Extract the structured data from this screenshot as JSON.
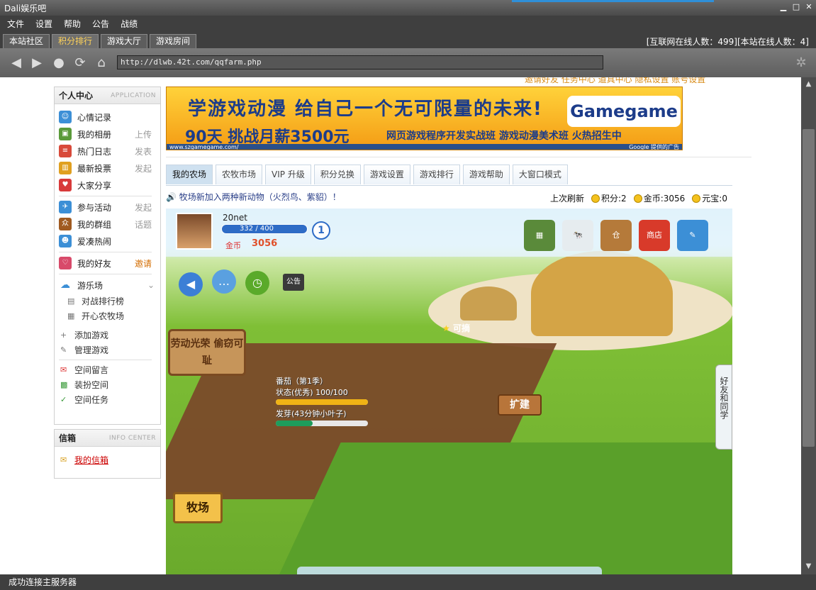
{
  "window": {
    "title": "Dali娱乐吧",
    "minimize": "▁",
    "maximize": "□",
    "close": "✕"
  },
  "menu": [
    "文件",
    "设置",
    "帮助",
    "公告",
    "战绩"
  ],
  "tabs": [
    {
      "label": "本站社区",
      "active": false
    },
    {
      "label": "积分排行",
      "active": true
    },
    {
      "label": "游戏大厅",
      "active": false
    },
    {
      "label": "游戏房间",
      "active": false
    }
  ],
  "online": "[互联网在线人数：499][本站在线人数：4]",
  "toolbar": {
    "address": "http://dlwb.42t.com/qqfarm.php"
  },
  "icons": {
    "back": "back-icon",
    "forward": "forward-icon",
    "stop": "stop-icon",
    "refresh": "refresh-icon",
    "home": "home-icon",
    "settings": "gear-icon"
  },
  "top_links": "邀请好友   任务中心   道具中心   隐私设置   账号设置",
  "personal": {
    "title": "个人中心",
    "title_en": "APPLICATION",
    "items": [
      {
        "label": "心情记录",
        "right": "",
        "color": "#3c8fd6"
      },
      {
        "label": "我的相册",
        "right": "上传",
        "color": "#5a9a3a"
      },
      {
        "label": "热门日志",
        "right": "发表",
        "color": "#d84a3a"
      },
      {
        "label": "最新投票",
        "right": "发起",
        "color": "#e0a020"
      },
      {
        "label": "大家分享",
        "right": "",
        "color": "#d83a3a"
      },
      {
        "label": "参与活动",
        "right": "发起",
        "color": "#3c8fd6"
      },
      {
        "label": "我的群组",
        "right": "话题",
        "color": "#a05a20"
      },
      {
        "label": "爱凑热闹",
        "right": "",
        "color": "#3c8fd6"
      },
      {
        "label": "我的好友",
        "right": "邀请",
        "color": "#d84a6a"
      }
    ],
    "games_label": "游乐场",
    "games": [
      "对战排行榜",
      "开心农牧场"
    ],
    "manage": [
      "添加游戏",
      "管理游戏"
    ],
    "space": [
      "空间留言",
      "装扮空间",
      "空间任务"
    ]
  },
  "inbox": {
    "title": "信箱",
    "title_en": "INFO CENTER",
    "link": "我的信箱"
  },
  "banner": {
    "line1": "学游戏动漫 给自己一个无可限量的未来!",
    "line2": "90天 挑战月薪3500元",
    "line3": "网页游戏程序开发实战班  游戏动漫美术班  火热招生中",
    "brand": "Gamegame",
    "url": "www.szgamegame.com/",
    "ads": "Google 提供的广告"
  },
  "game_tabs": [
    "我的农场",
    "农牧市场",
    "VIP 升级",
    "积分兑换",
    "游戏设置",
    "游戏排行",
    "游戏帮助",
    "大窗口模式"
  ],
  "notice": "牧场新加入两种新动物（火烈鸟、紫貂）！",
  "stats": {
    "refresh": "上次刷新",
    "points": "积分:2",
    "gold": "金币:3056",
    "ingot": "元宝:0"
  },
  "farm": {
    "player": "20net",
    "exp": "332 / 400",
    "exp_fraction": 0.83,
    "level": "1",
    "gold_label": "金币",
    "gold": "3056",
    "announce": "公告",
    "sign": "劳动光荣 偷窃可耻",
    "harvest": "可摘",
    "crop": {
      "name": "番茄（第1季）",
      "state": "状态(优秀) 100/100",
      "growth": "发芽(43分钟小叶子)"
    },
    "expand": "扩建",
    "friends": "好友和同学",
    "pasture": "牧场",
    "shop": "商店"
  },
  "status": "成功连接主服务器"
}
